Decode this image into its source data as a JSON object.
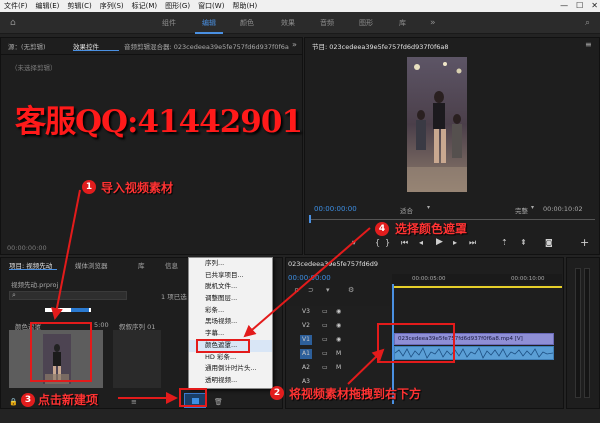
{
  "menubar": {
    "items": [
      "文件(F)",
      "编辑(E)",
      "剪辑(C)",
      "序列(S)",
      "标记(M)",
      "图形(G)",
      "窗口(W)",
      "帮助(H)"
    ]
  },
  "window_buttons": {
    "min": "—",
    "max": "☐",
    "close": "✕"
  },
  "workspaces": [
    "组件",
    "编辑",
    "颜色",
    "效果",
    "音频",
    "图形",
    "库"
  ],
  "workspace_active": "编辑",
  "source_panel": {
    "tabs": [
      "源：(无剪辑)",
      "效果控件",
      "音频剪辑混合器: 023cedeea39e5fe757fd6d937f0f6a8"
    ],
    "no_clip": "（未选择剪辑）",
    "timecode": "00:00:00:00"
  },
  "program_panel": {
    "title": "节目: 023cedeea39e5fe757fd6d937f0f6a8",
    "timecode": "00:00:00:00",
    "fit": "适合",
    "quality": "完整",
    "duration": "00:00:10:02"
  },
  "project_panel": {
    "tabs": [
      "项目: 视频先动",
      "媒体浏览器",
      "库",
      "信息"
    ],
    "file": "视频先动.prproj",
    "count": "1 项已选",
    "item1_label": "颜色遮罩",
    "item1_duration": "5:00",
    "item2_label": "叙叙序列 01"
  },
  "context_menu": {
    "items": [
      "序列...",
      "已共享项目...",
      "脱机文件...",
      "调整图层...",
      "彩条...",
      "黑场视频...",
      "字幕...",
      "颜色遮罩...",
      "HD 彩条...",
      "通用倒计时片头...",
      "透明视频..."
    ],
    "highlighted": "颜色遮罩..."
  },
  "timeline": {
    "title": "023cedeea39e5fe757fd6d937f0f6a8",
    "timecode": "00:00:00:00",
    "ruler": [
      "00:00:05:00",
      "00:00:10:00"
    ],
    "tracks": [
      "V3",
      "V2",
      "V1",
      "A1",
      "A2",
      "A3"
    ],
    "clip_label": "023cedeea39e5fe757fd6d937f0f6a8.mp4 [V]"
  },
  "watermark": "客服QQ:41442901",
  "callouts": [
    {
      "num": "1",
      "text": "导入视频素材"
    },
    {
      "num": "2",
      "text": "将视频素材拖拽到右下方"
    },
    {
      "num": "3",
      "text": "点击新建项"
    },
    {
      "num": "4",
      "text": "选择颜色遮罩"
    }
  ],
  "colors": {
    "annotation_red": "#e31b1b",
    "accent_blue": "#4a90e2",
    "clip_v": "#8f8fd6",
    "clip_a": "#5b9fd6"
  }
}
